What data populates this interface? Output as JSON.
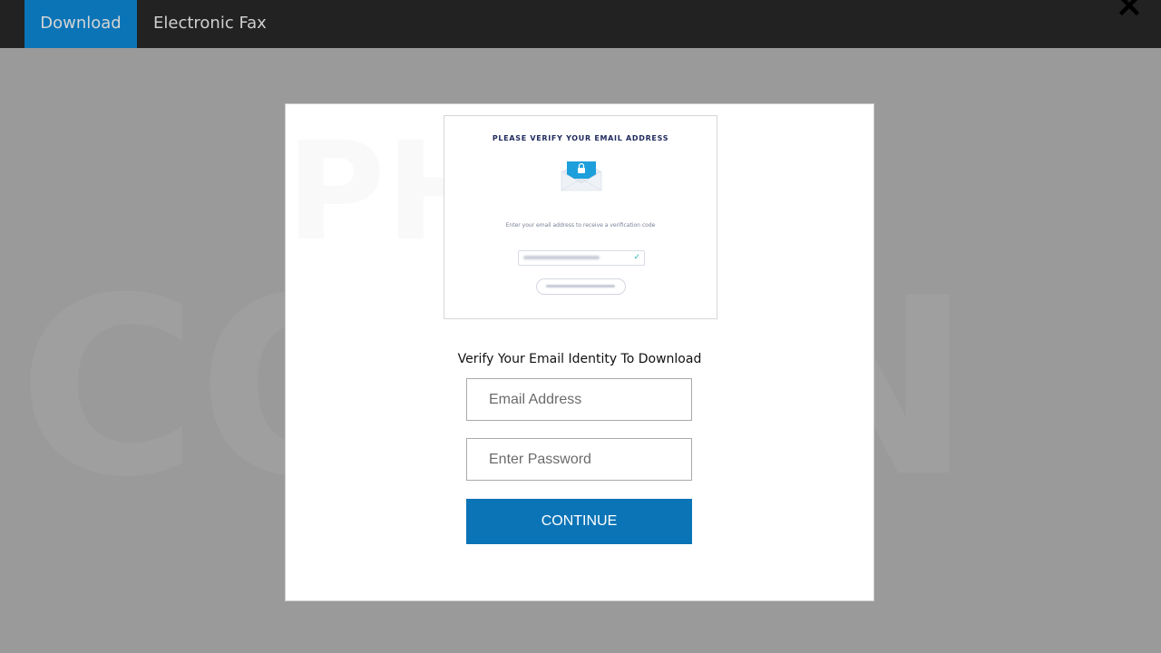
{
  "topbar": {
    "tabs": [
      {
        "label": "Download",
        "active": true
      },
      {
        "label": "Electronic Fax",
        "active": false
      }
    ],
    "close_icon": "close-x-icon"
  },
  "modal": {
    "preview": {
      "title": "PLEASE VERIFY YOUR EMAIL ADDRESS",
      "envelope_icon": "envelope-lock-icon",
      "description": "Enter your email address to receive a verification code",
      "check_icon": "checkmark-icon"
    },
    "heading": "Verify Your Email Identity To Download",
    "email_field": {
      "placeholder": "Email Address",
      "value": ""
    },
    "password_field": {
      "placeholder": "Enter Password",
      "value": ""
    },
    "continue_label": "CONTINUE"
  },
  "colors": {
    "accent": "#0b74b7",
    "topbar": "#222222",
    "overlay": "#9a9a9a"
  }
}
